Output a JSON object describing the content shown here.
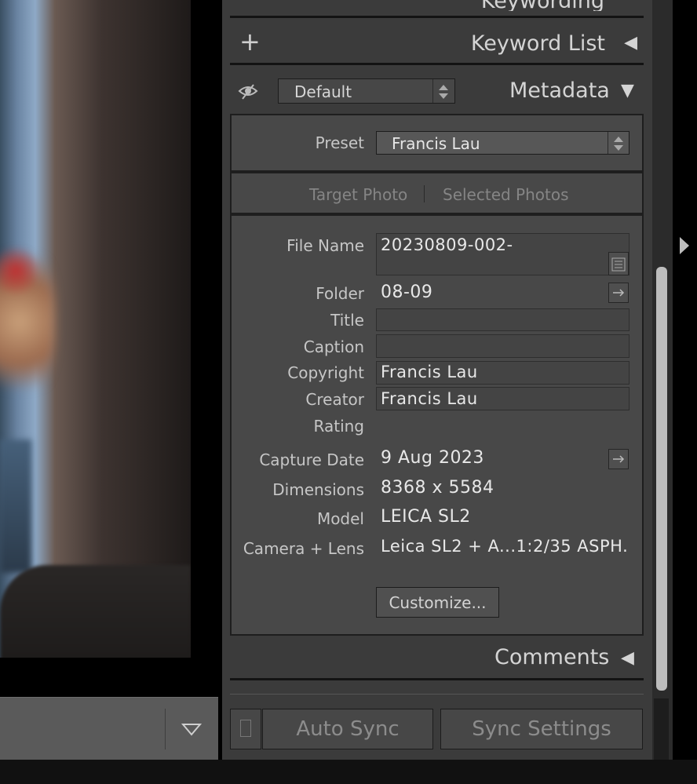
{
  "panel": {
    "partial_header": "Keywording",
    "keyword_list": {
      "add": "+",
      "title": "Keyword List",
      "arrow": "◀"
    },
    "metadata": {
      "preset_dropdown": "Default",
      "title": "Metadata",
      "arrow": "▼",
      "preset_label": "Preset",
      "preset_value": "Francis Lau",
      "target_photo": "Target Photo",
      "selected_photos": "Selected Photos",
      "fields": {
        "file_name_label": "File Name",
        "file_name": "20230809-002-",
        "folder_label": "Folder",
        "folder": "08-09",
        "title_label": "Title",
        "title": "",
        "caption_label": "Caption",
        "caption": "",
        "copyright_label": "Copyright",
        "copyright": "Francis Lau",
        "creator_label": "Creator",
        "creator": "Francis Lau",
        "rating_label": "Rating",
        "capture_date_label": "Capture Date",
        "capture_date": "9 Aug 2023",
        "dimensions_label": "Dimensions",
        "dimensions": "8368 x 5584",
        "model_label": "Model",
        "model": "LEICA SL2",
        "camera_lens_label": "Camera + Lens",
        "camera_lens": "Leica SL2 + A...1:2/35 ASPH."
      },
      "customize": "Customize..."
    },
    "comments": {
      "title": "Comments",
      "arrow": "◀"
    },
    "auto_sync": "Auto Sync",
    "sync_settings": "Sync Settings"
  },
  "icons": [
    "eye-icon",
    "updown-icon",
    "list-icon",
    "arrow-right-icon",
    "triangle-down-icon",
    "panel-collapse-icon"
  ]
}
